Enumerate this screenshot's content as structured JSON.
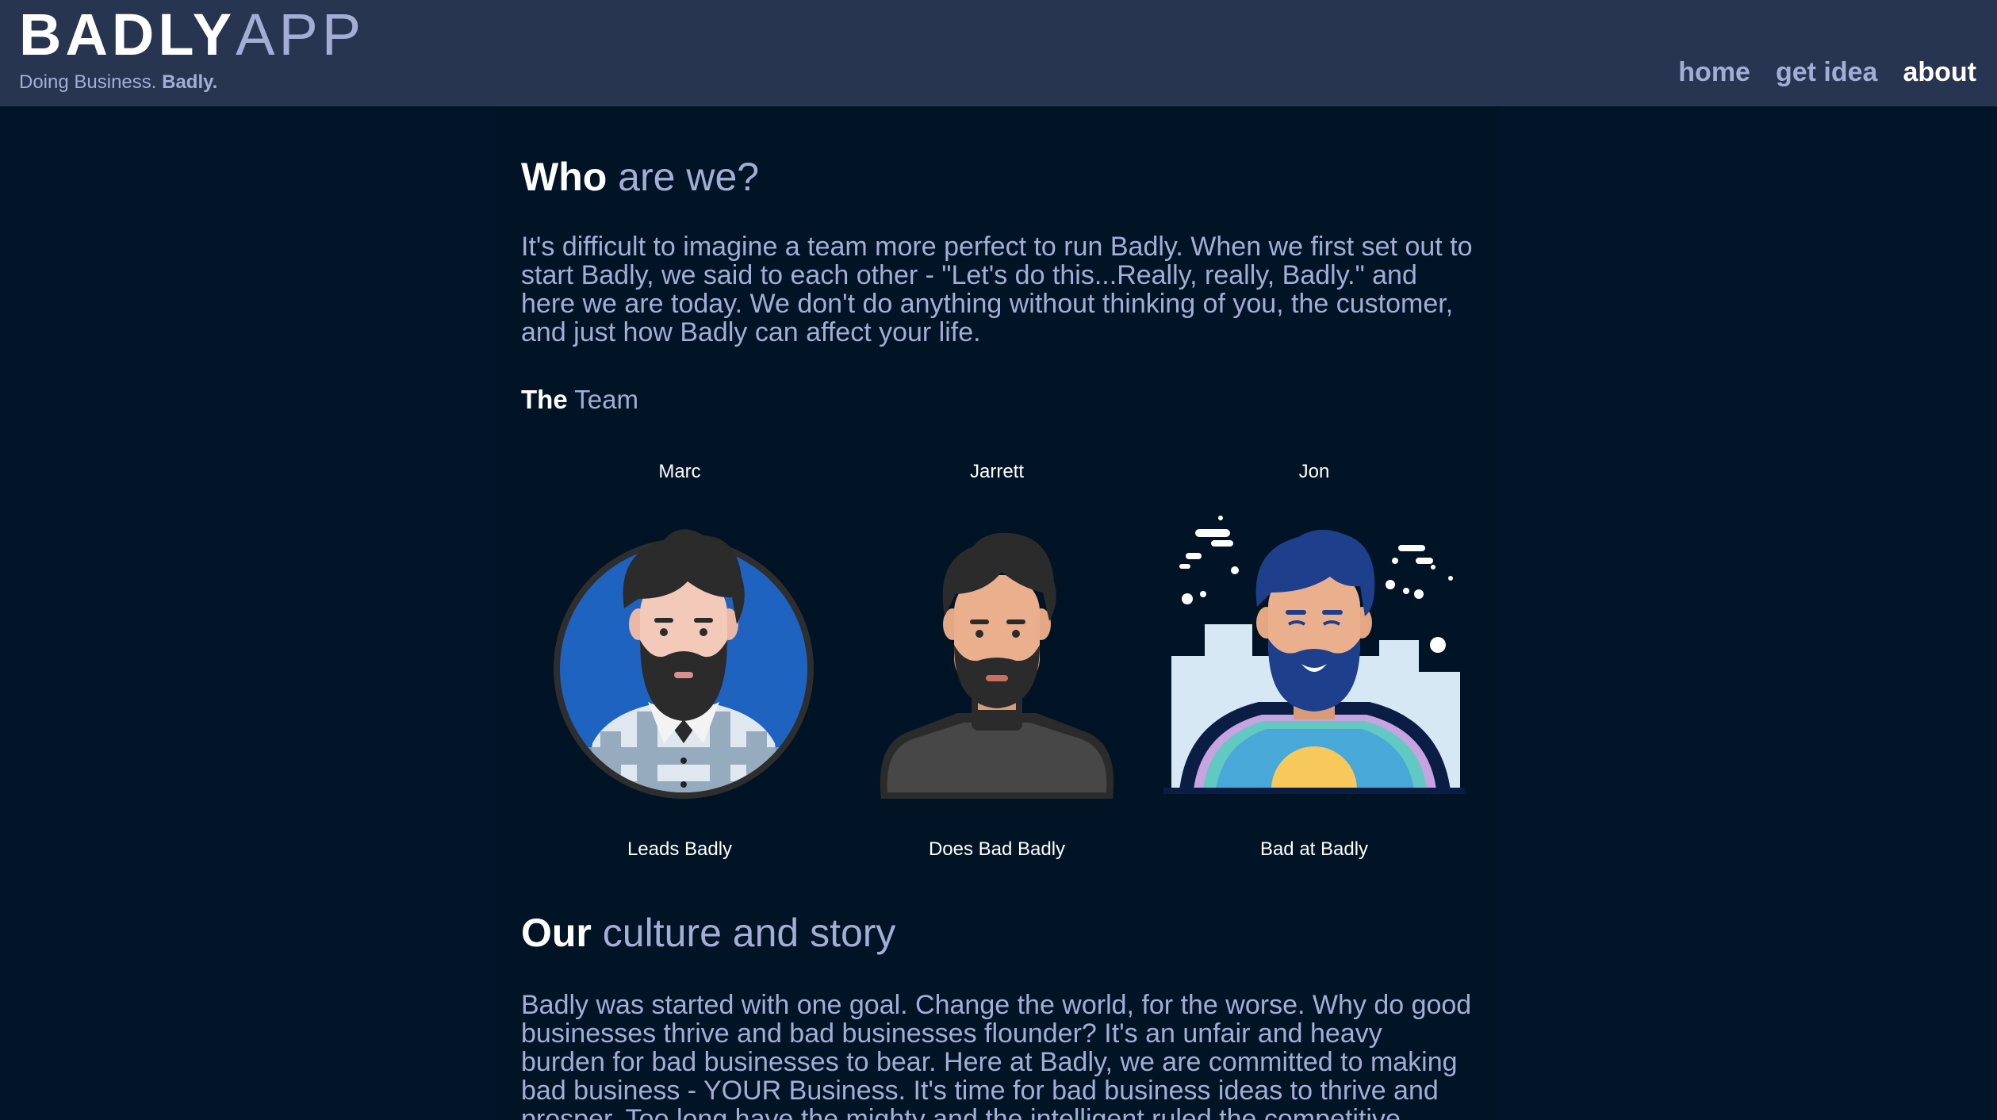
{
  "brand": {
    "name_bold": "BADLY",
    "name_light": "APP",
    "tagline_prefix": "Doing Business.",
    "tagline_bold": "Badly."
  },
  "nav": {
    "items": [
      {
        "label": "home"
      },
      {
        "label": "get idea"
      },
      {
        "label": "about"
      }
    ]
  },
  "about": {
    "heading_bold": "Who",
    "heading_rest": " are we?",
    "intro": "It's difficult to imagine a team more perfect to run Badly. When we first set out to start Badly, we said to each other - \"Let's do this...Really, really, Badly.\" and here we are today. We don't do anything without thinking of you, the customer, and just how Badly can affect your life.",
    "team_heading_bold": "The",
    "team_heading_rest": " Team",
    "team": [
      {
        "name": "Marc",
        "role": "Leads Badly",
        "avatar_icon": "bearded-man-plaid-avatar-icon"
      },
      {
        "name": "Jarrett",
        "role": "Does Bad Badly",
        "avatar_icon": "bearded-man-turtleneck-avatar-icon"
      },
      {
        "name": "Jon",
        "role": "Bad at Badly",
        "avatar_icon": "bearded-man-winter-avatar-icon"
      }
    ],
    "culture_heading_bold": "Our",
    "culture_heading_rest": " culture and story",
    "culture": "Badly was started with one goal. Change the world, for the worse. Why do good businesses thrive and bad businesses flounder? It's an unfair and heavy burden for bad businesses to bear. Here at Badly, we are committed to making bad business - YOUR Business. It's time for bad business ideas to thrive and prosper. Too long have the mighty and the intelligent ruled the competitive spaces of business! At"
  },
  "colors": {
    "header_bg": "#283550",
    "page_bg": "#02142a",
    "content_bg": "#011425",
    "accent_text": "#a3add6",
    "white": "#ffffff"
  }
}
